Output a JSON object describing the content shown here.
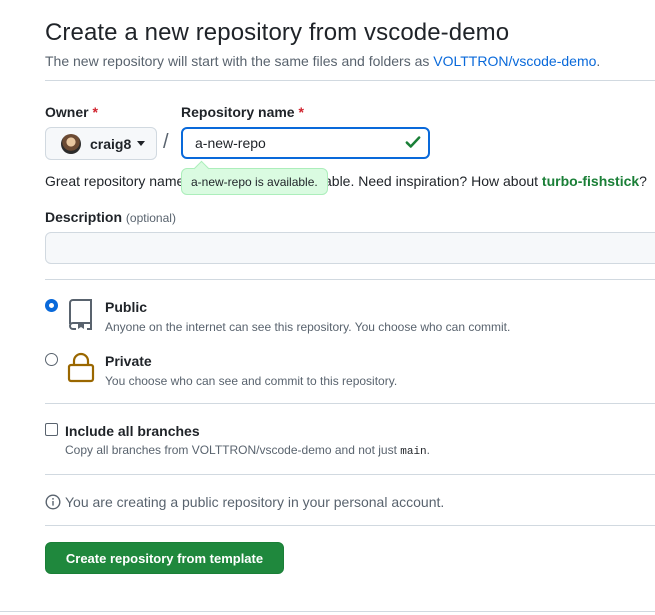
{
  "header": {
    "title": "Create a new repository from vscode-demo",
    "subtitle_prefix": "The new repository will start with the same files and folders as ",
    "subtitle_link": "VOLTTRON/vscode-demo",
    "subtitle_suffix": "."
  },
  "owner": {
    "label": "Owner",
    "required_mark": "*",
    "value": "craig8"
  },
  "separator": "/",
  "repo_name": {
    "label": "Repository name",
    "required_mark": "*",
    "value": "a-new-repo",
    "availability": "a-new-repo is available."
  },
  "hint": {
    "prefix": "Great repository name",
    "middle": "able. Need inspiration? How about ",
    "suggestion": "turbo-fishstick",
    "suffix": "?"
  },
  "description": {
    "label": "Description",
    "optional": "(optional)",
    "value": ""
  },
  "visibility": {
    "public": {
      "title": "Public",
      "desc": "Anyone on the internet can see this repository. You choose who can commit.",
      "selected": true
    },
    "private": {
      "title": "Private",
      "desc": "You choose who can see and commit to this repository.",
      "selected": false
    }
  },
  "branches": {
    "title": "Include all branches",
    "desc_prefix": "Copy all branches from VOLTTRON/vscode-demo and not just ",
    "desc_code": "main",
    "desc_suffix": ".",
    "checked": false
  },
  "info": {
    "text": "You are creating a public repository in your personal account."
  },
  "submit": {
    "label": "Create repository from template"
  },
  "colors": {
    "link": "#0969da",
    "success": "#1a7f37",
    "primary_button": "#1f883d",
    "required": "#d1242f",
    "private_lock": "#9a6700"
  },
  "icons": {
    "owner_caret": "triangle-down-icon",
    "valid": "check-icon",
    "public": "repo-icon",
    "private": "lock-icon",
    "info": "info-icon"
  }
}
